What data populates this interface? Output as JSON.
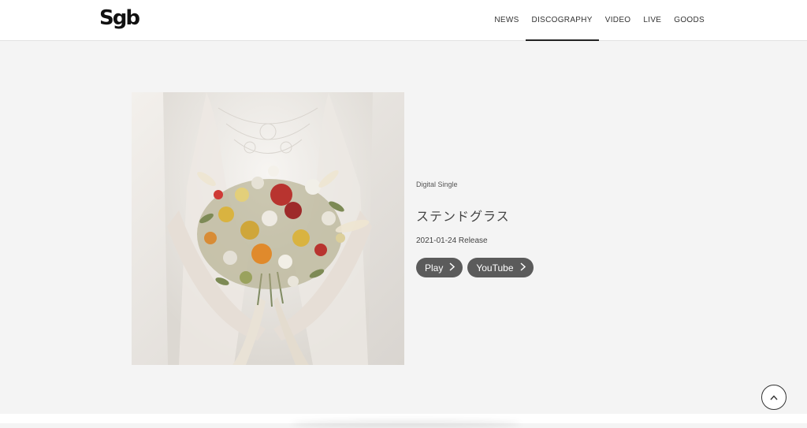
{
  "header": {
    "logo": "Sgb",
    "nav": [
      {
        "label": "NEWS",
        "active": false
      },
      {
        "label": "DISCOGRAPHY",
        "active": true
      },
      {
        "label": "VIDEO",
        "active": false
      },
      {
        "label": "LIVE",
        "active": false
      },
      {
        "label": "GOODS",
        "active": false
      }
    ]
  },
  "release": {
    "type": "Digital Single",
    "title": "ステンドグラス",
    "date": "2021-01-24 Release",
    "cover_image": "wedding-bouquet-cover",
    "buttons": [
      {
        "label": "Play",
        "icon": "chevron-right-icon"
      },
      {
        "label": "YouTube",
        "icon": "chevron-right-icon"
      }
    ]
  },
  "scroll_top": {
    "icon": "chevron-up-icon"
  },
  "colors": {
    "background": "#f4f4f4",
    "header": "#ffffff",
    "pill": "#5b5b5b",
    "text": "#333333"
  }
}
